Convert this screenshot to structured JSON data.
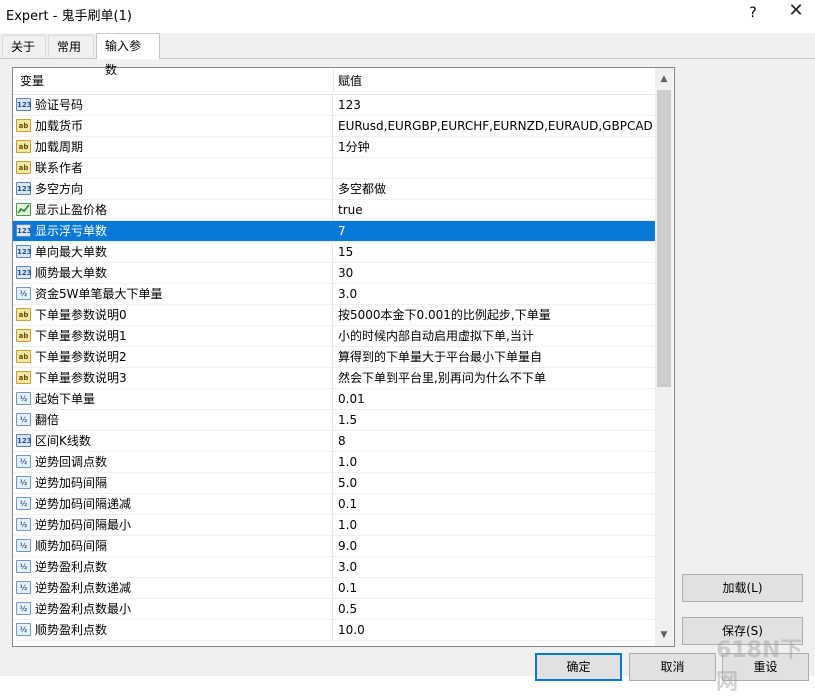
{
  "window": {
    "title": "Expert - 鬼手刷单(1)",
    "help": "?",
    "close": "✕"
  },
  "tabs": [
    {
      "label": "关于"
    },
    {
      "label": "常用"
    },
    {
      "label": "输入参数"
    }
  ],
  "table": {
    "headers": {
      "variable": "变量",
      "value": "赋值"
    },
    "rows": [
      {
        "name": "验证号码",
        "value": "123",
        "type": "123"
      },
      {
        "name": "加载货币",
        "value": "EURusd,EURGBP,EURCHF,EURNZD,EURAUD,GBPCAD...",
        "type": "ab"
      },
      {
        "name": "加载周期",
        "value": "1分钟",
        "type": "ab"
      },
      {
        "name": "联系作者",
        "value": "",
        "type": "ab"
      },
      {
        "name": "多空方向",
        "value": "多空都做",
        "type": "123"
      },
      {
        "name": "显示止盈价格",
        "value": "true",
        "type": "bool"
      },
      {
        "name": "显示浮亏单数",
        "value": "7",
        "type": "123"
      },
      {
        "name": "单向最大单数",
        "value": "15",
        "type": "123"
      },
      {
        "name": "顺势最大单数",
        "value": "30",
        "type": "123"
      },
      {
        "name": "资金5W单笔最大下单量",
        "value": "3.0",
        "type": "½"
      },
      {
        "name": "下单量参数说明0",
        "value": "按5000本金下0.001的比例起步,下单量",
        "type": "ab"
      },
      {
        "name": "下单量参数说明1",
        "value": "小的时候内部自动启用虚拟下单,当计",
        "type": "ab"
      },
      {
        "name": "下单量参数说明2",
        "value": "算得到的下单量大于平台最小下单量自",
        "type": "ab"
      },
      {
        "name": "下单量参数说明3",
        "value": "然会下单到平台里,别再问为什么不下单",
        "type": "ab"
      },
      {
        "name": "起始下单量",
        "value": "0.01",
        "type": "½"
      },
      {
        "name": "翻倍",
        "value": "1.5",
        "type": "½"
      },
      {
        "name": "区间K线数",
        "value": "8",
        "type": "123"
      },
      {
        "name": "逆势回调点数",
        "value": "1.0",
        "type": "½"
      },
      {
        "name": "逆势加码间隔",
        "value": "5.0",
        "type": "½"
      },
      {
        "name": "逆势加码间隔递减",
        "value": "0.1",
        "type": "½"
      },
      {
        "name": "逆势加码间隔最小",
        "value": "1.0",
        "type": "½"
      },
      {
        "name": "顺势加码间隔",
        "value": "9.0",
        "type": "½"
      },
      {
        "name": "逆势盈利点数",
        "value": "3.0",
        "type": "½"
      },
      {
        "name": "逆势盈利点数递减",
        "value": "0.1",
        "type": "½"
      },
      {
        "name": "逆势盈利点数最小",
        "value": "0.5",
        "type": "½"
      },
      {
        "name": "顺势盈利点数",
        "value": "10.0",
        "type": "½"
      }
    ],
    "selected_index": 6
  },
  "scroll": {
    "up": "▲",
    "down": "▼"
  },
  "buttons": {
    "load": "加载(L)",
    "save": "保存(S)",
    "ok": "确定",
    "cancel": "取消",
    "reset": "重设"
  },
  "watermark": "618N下网"
}
